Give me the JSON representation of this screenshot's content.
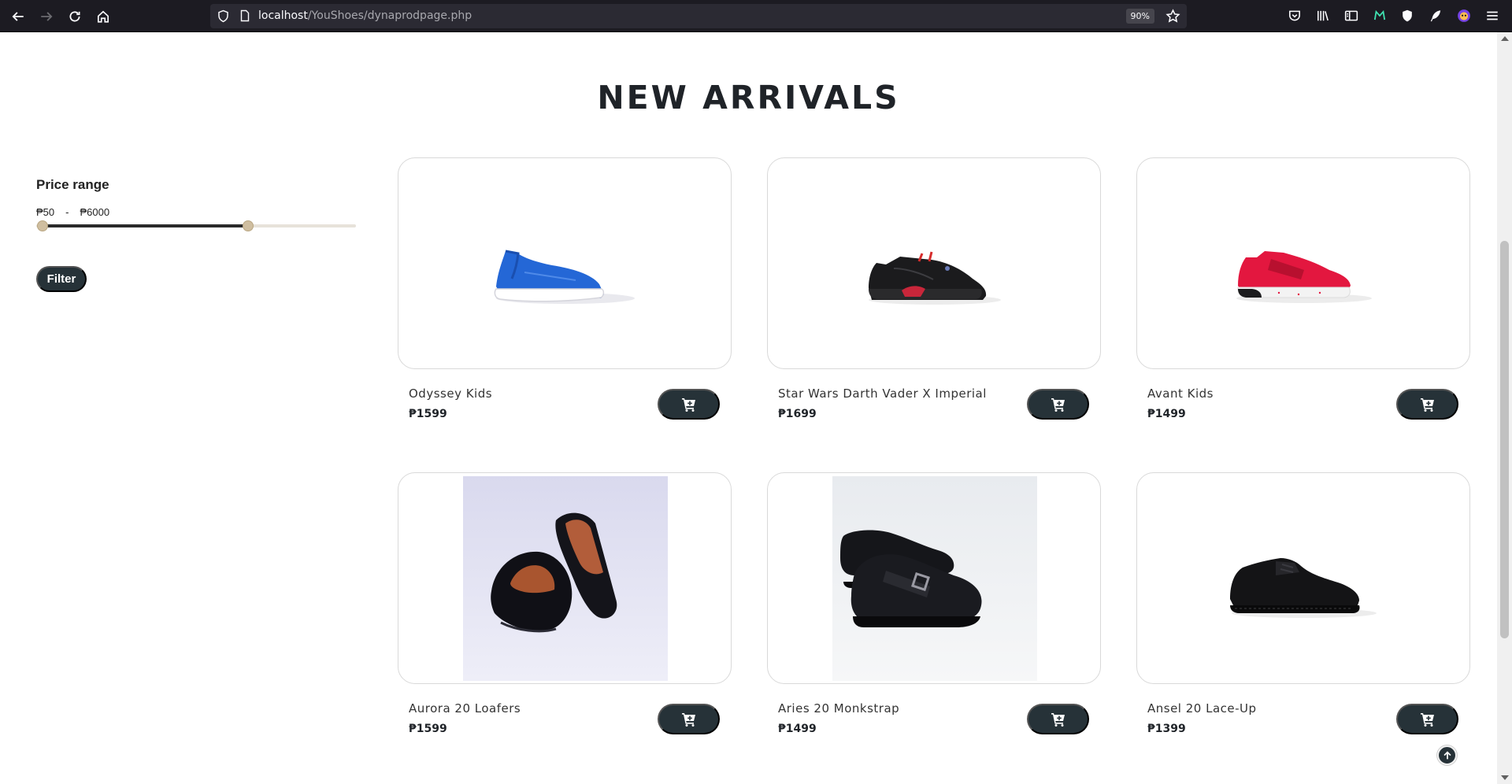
{
  "browser": {
    "url_host": "localhost",
    "url_path": "/YouShoes/dynaprodpage.php",
    "zoom": "90%"
  },
  "page": {
    "title": "NEW ARRIVALS"
  },
  "filter": {
    "title": "Price range",
    "min_label": "₱50",
    "separator": "-",
    "max_label": "₱6000",
    "button_label": "Filter",
    "range_min_fraction": 0.0,
    "range_max_fraction": 0.67
  },
  "products": [
    {
      "name": "Odyssey Kids",
      "price": "₱1599",
      "image": "blue-knit-sneaker"
    },
    {
      "name": "Star Wars Darth Vader X Imperial",
      "price": "₱1699",
      "image": "black-red-sneaker"
    },
    {
      "name": "Avant Kids",
      "price": "₱1499",
      "image": "red-velcro-sneaker"
    },
    {
      "name": "Aurora 20 Loafers",
      "price": "₱1599",
      "image": "black-leather-loafers-photo"
    },
    {
      "name": "Aries 20 Monkstrap",
      "price": "₱1499",
      "image": "black-monkstrap-photo"
    },
    {
      "name": "Ansel 20 Lace-Up",
      "price": "₱1399",
      "image": "black-lace-up-shoe"
    }
  ],
  "colors": {
    "button_dark": "#263238",
    "slider_track": "#e7e2da",
    "slider_handle": "#cfbea0"
  }
}
